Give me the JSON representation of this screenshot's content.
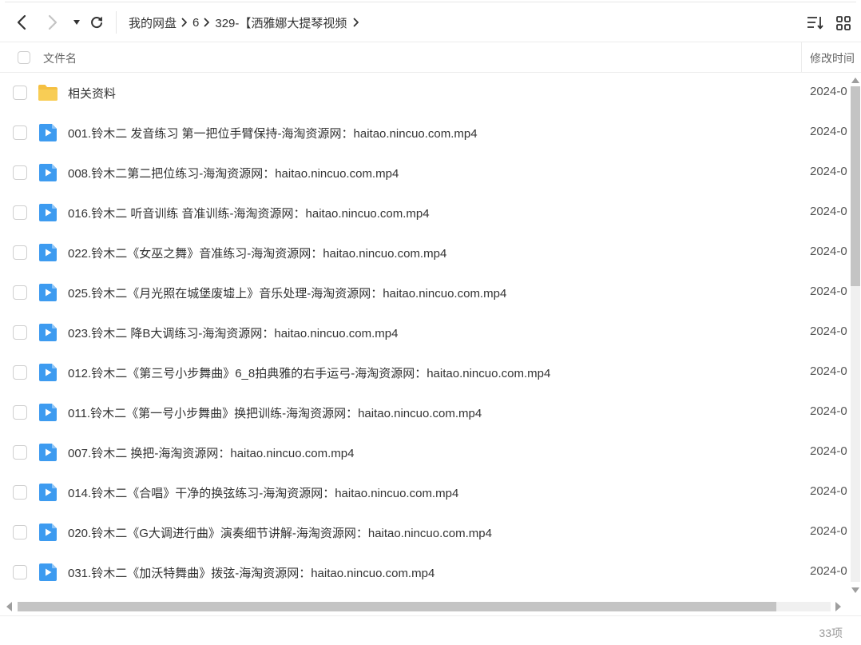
{
  "breadcrumb": {
    "items": [
      "我的网盘",
      "6",
      "329-【洒雅娜大提琴视频"
    ]
  },
  "header": {
    "name_col": "文件名",
    "date_col": "修改时间"
  },
  "files": [
    {
      "name": "相关资料",
      "date": "2024-0",
      "type": "folder"
    },
    {
      "name": "001.铃木二 发音练习 第一把位手臂保持-海淘资源网：haitao.nincuo.com.mp4",
      "date": "2024-0",
      "type": "video"
    },
    {
      "name": "008.铃木二第二把位练习-海淘资源网：haitao.nincuo.com.mp4",
      "date": "2024-0",
      "type": "video"
    },
    {
      "name": "016.铃木二 听音训练 音准训练-海淘资源网：haitao.nincuo.com.mp4",
      "date": "2024-0",
      "type": "video"
    },
    {
      "name": "022.铃木二《女巫之舞》音准练习-海淘资源网：haitao.nincuo.com.mp4",
      "date": "2024-0",
      "type": "video"
    },
    {
      "name": "025.铃木二《月光照在城堡废墟上》音乐处理-海淘资源网：haitao.nincuo.com.mp4",
      "date": "2024-0",
      "type": "video"
    },
    {
      "name": "023.铃木二 降B大调练习-海淘资源网：haitao.nincuo.com.mp4",
      "date": "2024-0",
      "type": "video"
    },
    {
      "name": "012.铃木二《第三号小步舞曲》6_8拍典雅的右手运弓-海淘资源网：haitao.nincuo.com.mp4",
      "date": "2024-0",
      "type": "video"
    },
    {
      "name": "011.铃木二《第一号小步舞曲》换把训练-海淘资源网：haitao.nincuo.com.mp4",
      "date": "2024-0",
      "type": "video"
    },
    {
      "name": "007.铃木二 换把-海淘资源网：haitao.nincuo.com.mp4",
      "date": "2024-0",
      "type": "video"
    },
    {
      "name": "014.铃木二《合唱》干净的换弦练习-海淘资源网：haitao.nincuo.com.mp4",
      "date": "2024-0",
      "type": "video"
    },
    {
      "name": "020.铃木二《G大调进行曲》演奏细节讲解-海淘资源网：haitao.nincuo.com.mp4",
      "date": "2024-0",
      "type": "video"
    },
    {
      "name": "031.铃木二《加沃特舞曲》拨弦-海淘资源网：haitao.nincuo.com.mp4",
      "date": "2024-0",
      "type": "video"
    }
  ],
  "footer": {
    "count": "33项"
  },
  "colors": {
    "folder": "#f5c042",
    "video": "#3d9bf0",
    "text": "#333333",
    "muted": "#999999"
  }
}
